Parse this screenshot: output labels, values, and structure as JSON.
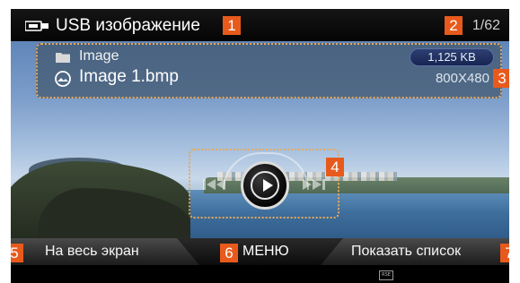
{
  "header": {
    "title": "USB изображение",
    "counter": "1/62",
    "usb_icon": "usb-device-icon"
  },
  "info": {
    "folder_name": "Image",
    "file_size": "1,125 KB",
    "file_name": "Image 1.bmp",
    "resolution": "800X480"
  },
  "controls": {
    "prev_icon": "rewind-icon",
    "play_icon": "play-icon",
    "next_icon": "fast-forward-icon"
  },
  "bottom": {
    "fullscreen_label": "На весь экран",
    "menu_label": "МЕНЮ",
    "list_label": "Показать список"
  },
  "footer": {
    "rse_label": "RSE"
  },
  "callouts": [
    "1",
    "2",
    "3",
    "4",
    "5",
    "6",
    "7"
  ],
  "colors": {
    "callout": "#e85a1c",
    "highlight_border": "#e8a85a",
    "size_pill": "#172552"
  }
}
